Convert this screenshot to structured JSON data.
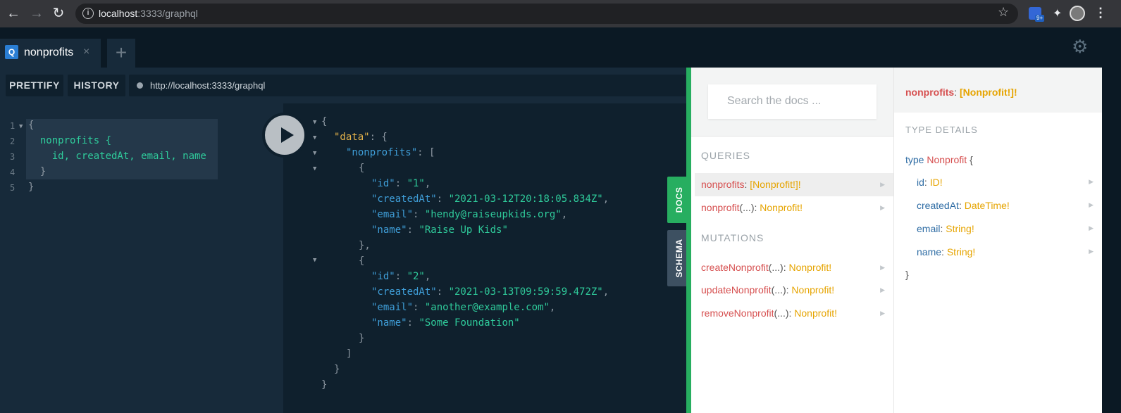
{
  "browser": {
    "url_host": "localhost",
    "url_path": ":3333/graphql",
    "ext_badge_count": "9+"
  },
  "tabs": [
    {
      "badge": "Q",
      "title": "nonprofits",
      "close": "×"
    }
  ],
  "tab_add": "+",
  "toolbar": {
    "prettify_label": "PRETTIFY",
    "history_label": "HISTORY",
    "endpoint_url": "http://localhost:3333/graphql"
  },
  "editor": {
    "line_numbers": [
      "1",
      "2",
      "3",
      "4",
      "5"
    ],
    "lines": [
      "{",
      "  nonprofits {",
      "    id, createdAt, email, name",
      "  }",
      "}"
    ]
  },
  "result": {
    "data_key": "\"data\"",
    "list_key": "\"nonprofits\"",
    "items": [
      {
        "id": "\"1\"",
        "createdAt": "\"2021-03-12T20:18:05.834Z\"",
        "email": "\"hendy@raiseupkids.org\"",
        "name": "\"Raise Up Kids\""
      },
      {
        "id": "\"2\"",
        "createdAt": "\"2021-03-13T09:59:59.472Z\"",
        "email": "\"another@example.com\"",
        "name": "\"Some Foundation\""
      }
    ]
  },
  "side_tabs": {
    "docs": "DOCS",
    "schema": "SCHEMA"
  },
  "docs": {
    "search_placeholder": "Search the docs ...",
    "queries_header": "QUERIES",
    "mutations_header": "MUTATIONS",
    "queries": [
      {
        "name": "nonprofits",
        "args": "",
        "type": "[Nonprofit!]!"
      },
      {
        "name": "nonprofit",
        "args": "(...)",
        "type": "Nonprofit!"
      }
    ],
    "mutations": [
      {
        "name": "createNonprofit",
        "args": "(...)",
        "type": "Nonprofit!"
      },
      {
        "name": "updateNonprofit",
        "args": "(...)",
        "type": "Nonprofit!"
      },
      {
        "name": "removeNonprofit",
        "args": "(...)",
        "type": "Nonprofit!"
      }
    ]
  },
  "type_details": {
    "field_name": "nonprofits",
    "field_type": "[Nonprofit!]!",
    "section_header": "TYPE DETAILS",
    "type_keyword": "type",
    "type_name": "Nonprofit",
    "open_brace": "{",
    "close_brace": "}",
    "fields": [
      {
        "name": "id",
        "type": "ID!"
      },
      {
        "name": "createdAt",
        "type": "DateTime!"
      },
      {
        "name": "email",
        "type": "String!"
      },
      {
        "name": "name",
        "type": "String!"
      }
    ]
  },
  "colors": {
    "docs_accent": "#27ae60",
    "schema_tab": "#3d5061",
    "field_name": "#d64f4f",
    "field_type": "#e6a400"
  }
}
